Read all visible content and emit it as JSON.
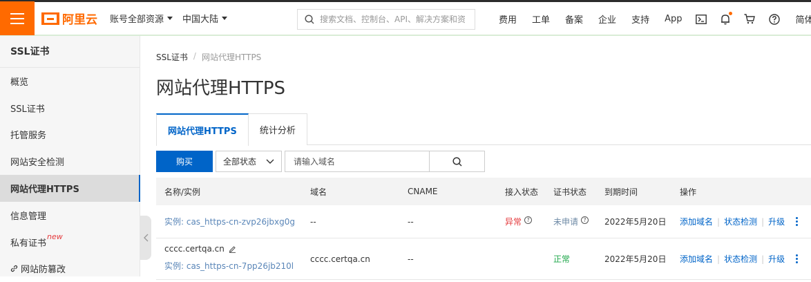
{
  "header": {
    "logo_text": "阿里云",
    "account_menu": "账号全部资源",
    "region_menu": "中国大陆",
    "search_placeholder": "搜索文档、控制台、API、解决方案和资",
    "nav": [
      "费用",
      "工单",
      "备案",
      "企业",
      "支持",
      "App"
    ],
    "language": "简体",
    "brand_color": "#ff6a00"
  },
  "sidebar": {
    "title": "SSL证书",
    "items": [
      {
        "label": "概览"
      },
      {
        "label": "SSL证书"
      },
      {
        "label": "托管服务"
      },
      {
        "label": "网站安全检测"
      },
      {
        "label": "网站代理HTTPS"
      },
      {
        "label": "信息管理"
      },
      {
        "label": "私有证书",
        "badge": "new"
      },
      {
        "label": "网站防篡改"
      }
    ],
    "active_index": 4
  },
  "breadcrumb": {
    "root": "SSL证书",
    "sep": "/",
    "current": "网站代理HTTPS"
  },
  "page_title": "网站代理HTTPS",
  "tabs": [
    {
      "label": "网站代理HTTPS",
      "active": true
    },
    {
      "label": "统计分析",
      "active": false
    }
  ],
  "toolbar": {
    "buy_label": "购买",
    "status_value": "全部状态",
    "domain_placeholder": "请输入域名"
  },
  "table": {
    "columns": [
      "名称/实例",
      "域名",
      "CNAME",
      "接入状态",
      "证书状态",
      "到期时间",
      "操作"
    ],
    "rows": [
      {
        "instance": "实例: cas_https-cn-zvp26jbxg0g",
        "domain": "--",
        "cname": "--",
        "access_status": "异常",
        "cert_status": "未申请",
        "expiry": "2022年5月20日",
        "actions": [
          "添加域名",
          "状态检测",
          "升级"
        ]
      },
      {
        "name": "cccc.certqa.cn",
        "instance": "实例: cas_https-cn-7pp26jb210l",
        "domain": "cccc.certqa.cn",
        "cname": "--",
        "access_status": "",
        "cert_status": "正常",
        "expiry": "2022年5月20日",
        "actions": [
          "添加域名",
          "状态检测",
          "升级"
        ]
      }
    ]
  },
  "colors": {
    "primary": "#0064c8",
    "danger": "#e4393c",
    "success": "#1ea74a"
  }
}
